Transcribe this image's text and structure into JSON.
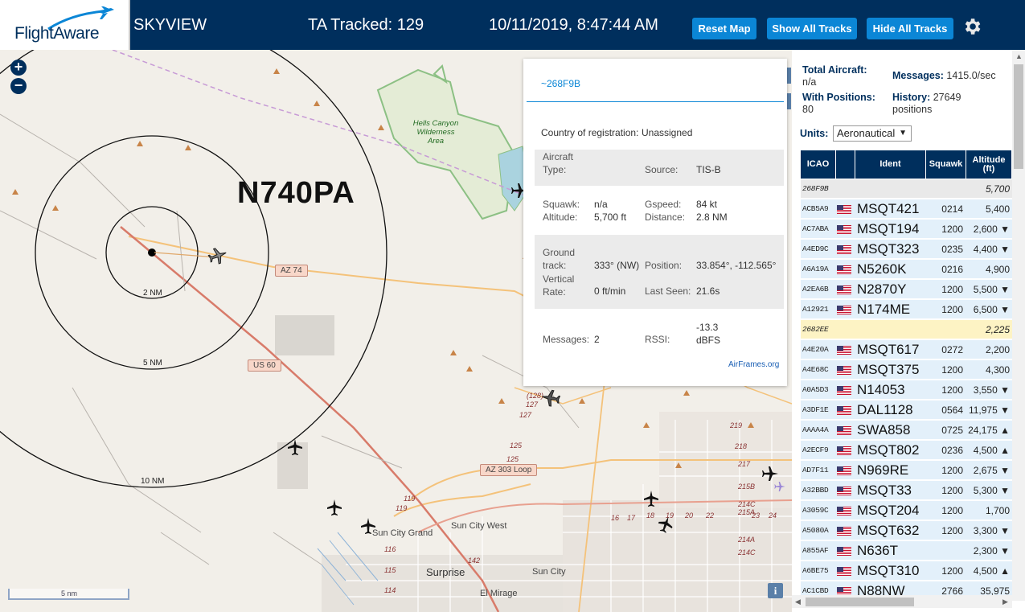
{
  "header": {
    "logo_text": "FlightAware",
    "app_name": "SKYVIEW",
    "tracked_label": "TA Tracked: 129",
    "datetime": "10/11/2019, 8:47:44 AM",
    "buttons": {
      "reset_map": "Reset Map",
      "show_all_tracks": "Show All Tracks",
      "hide_all_tracks": "Hide All Tracks"
    },
    "settings_icon": "gear-icon",
    "colors": {
      "header_bg": "#002f5d",
      "button_bg": "#0b86d6"
    }
  },
  "map": {
    "zoom_in": "+",
    "zoom_out": "−",
    "selected_callsign": "N740PA",
    "range_rings": [
      "2 NM",
      "5 NM",
      "10 NM"
    ],
    "road_shields": [
      "AZ 74",
      "US 60",
      "AZ 303 Loop"
    ],
    "park_label": "Hells Canyon Wilderness Area",
    "places": [
      "Sun City Grand",
      "Sun City West",
      "Surprise",
      "Sun City",
      "El Mirage"
    ],
    "road_numbers": [
      "(128)",
      "127",
      "127",
      "125",
      "125",
      "119",
      "119",
      "116",
      "115",
      "114",
      "142",
      "17",
      "16",
      "18",
      "19",
      "20",
      "22",
      "23",
      "24",
      "219",
      "218",
      "217",
      "215B",
      "215A",
      "214C",
      "214A",
      "214C"
    ],
    "scale_label": "5 nm",
    "info_button": "i"
  },
  "popup": {
    "icao": "~268F9B",
    "country_label": "Country of registration:",
    "country_value": "Unassigned",
    "aircraft_type_label": "Aircraft Type:",
    "source_label": "Source:",
    "source_value": "TIS-B",
    "squawk_label": "Squawk:",
    "squawk_value": "n/a",
    "altitude_label": "Altitude:",
    "altitude_value": "5,700 ft",
    "gspeed_label": "Gspeed:",
    "gspeed_value": "84 kt",
    "distance_label": "Distance:",
    "distance_value": "2.8 NM",
    "ground_track_label": "Ground track:",
    "ground_track_value": "333° (NW)",
    "position_label": "Position:",
    "position_value": "33.854°, -112.565°",
    "vrate_label": "Vertical Rate:",
    "vrate_value": "0 ft/min",
    "last_seen_label": "Last Seen:",
    "last_seen_value": "21.6s",
    "messages_label": "Messages:",
    "messages_value": "2",
    "rssi_label": "RSSI:",
    "rssi_value": "-13.3 dBFS",
    "link": "AirFrames.org"
  },
  "sidebar": {
    "total_aircraft_label": "Total Aircraft:",
    "total_aircraft_value": "n/a",
    "messages_label": "Messages:",
    "messages_value": "1415.0/sec",
    "with_positions_label": "With Positions:",
    "with_positions_value": "80",
    "history_label": "History:",
    "history_value": "27649 positions",
    "units_label": "Units:",
    "units_value": "Aeronautical",
    "columns": [
      "ICAO",
      "Ident",
      "Squawk",
      "Altitude (ft)"
    ],
    "rows": [
      {
        "icao": "268F9B",
        "flag": false,
        "ident": "",
        "squawk": "",
        "alt": "5,700",
        "style": "tisb"
      },
      {
        "icao": "ACB5A9",
        "flag": true,
        "ident": "MSQT421",
        "squawk": "0214",
        "alt": "5,400",
        "style": ""
      },
      {
        "icao": "AC7ABA",
        "flag": true,
        "ident": "MSQT194",
        "squawk": "1200",
        "alt": "2,600 ▼",
        "style": ""
      },
      {
        "icao": "A4ED9C",
        "flag": true,
        "ident": "MSQT323",
        "squawk": "0235",
        "alt": "4,400 ▼",
        "style": ""
      },
      {
        "icao": "A6A19A",
        "flag": true,
        "ident": "N5260K",
        "squawk": "0216",
        "alt": "4,900",
        "style": ""
      },
      {
        "icao": "A2EA6B",
        "flag": true,
        "ident": "N2870Y",
        "squawk": "1200",
        "alt": "5,500 ▼",
        "style": ""
      },
      {
        "icao": "A12921",
        "flag": true,
        "ident": "N174ME",
        "squawk": "1200",
        "alt": "6,500 ▼",
        "style": ""
      },
      {
        "icao": "2682EE",
        "flag": false,
        "ident": "",
        "squawk": "",
        "alt": "2,225",
        "style": "hl"
      },
      {
        "icao": "A4E20A",
        "flag": true,
        "ident": "MSQT617",
        "squawk": "0272",
        "alt": "2,200",
        "style": ""
      },
      {
        "icao": "A4E68C",
        "flag": true,
        "ident": "MSQT375",
        "squawk": "1200",
        "alt": "4,300",
        "style": ""
      },
      {
        "icao": "A0A5D3",
        "flag": true,
        "ident": "N14053",
        "squawk": "1200",
        "alt": "3,550 ▼",
        "style": ""
      },
      {
        "icao": "A3DF1E",
        "flag": true,
        "ident": "DAL1128",
        "squawk": "0564",
        "alt": "11,975 ▼",
        "style": ""
      },
      {
        "icao": "AAAA4A",
        "flag": true,
        "ident": "SWA858",
        "squawk": "0725",
        "alt": "24,175 ▲",
        "style": ""
      },
      {
        "icao": "A2ECF9",
        "flag": true,
        "ident": "MSQT802",
        "squawk": "0236",
        "alt": "4,500 ▲",
        "style": ""
      },
      {
        "icao": "AD7F11",
        "flag": true,
        "ident": "N969RE",
        "squawk": "1200",
        "alt": "2,675 ▼",
        "style": ""
      },
      {
        "icao": "A32BBD",
        "flag": true,
        "ident": "MSQT33",
        "squawk": "1200",
        "alt": "5,300 ▼",
        "style": ""
      },
      {
        "icao": "A3059C",
        "flag": true,
        "ident": "MSQT204",
        "squawk": "1200",
        "alt": "1,700",
        "style": ""
      },
      {
        "icao": "A5080A",
        "flag": true,
        "ident": "MSQT632",
        "squawk": "1200",
        "alt": "3,300 ▼",
        "style": ""
      },
      {
        "icao": "A855AF",
        "flag": true,
        "ident": "N636T",
        "squawk": "",
        "alt": "2,300 ▼",
        "style": ""
      },
      {
        "icao": "A6BE75",
        "flag": true,
        "ident": "MSQT310",
        "squawk": "1200",
        "alt": "4,500 ▲",
        "style": ""
      },
      {
        "icao": "AC1CBD",
        "flag": true,
        "ident": "N88NW",
        "squawk": "2766",
        "alt": "35,975",
        "style": ""
      }
    ]
  }
}
